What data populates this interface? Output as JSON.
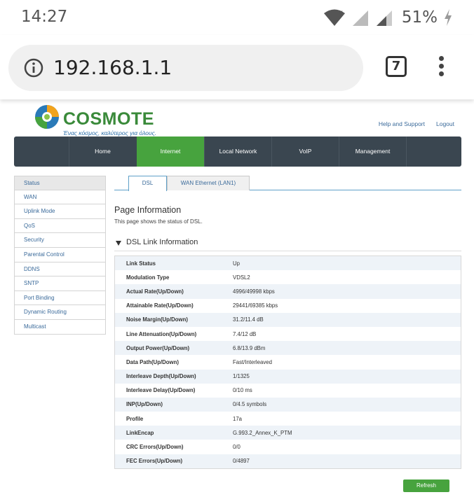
{
  "status_bar": {
    "time": "14:27",
    "battery": "51%",
    "icons": [
      "wifi-icon",
      "signal-no-sim-icon",
      "signal-icon",
      "charging-bolt-icon"
    ]
  },
  "browser": {
    "url": "192.168.1.1",
    "tab_count": "7"
  },
  "brand": {
    "name": "COSMOTE",
    "tagline": "Ένας κόσμος, καλύτερος για όλους.",
    "green": "#47a33e",
    "nav_bg": "#3a4650"
  },
  "top_links": {
    "help": "Help and Support",
    "logout": "Logout"
  },
  "main_nav": [
    {
      "label": "Home"
    },
    {
      "label": "Internet",
      "active": true
    },
    {
      "label": "Local Network"
    },
    {
      "label": "VoIP"
    },
    {
      "label": "Management"
    }
  ],
  "sidebar": [
    "Status",
    "WAN",
    "Uplink Mode",
    "QoS",
    "Security",
    "Parental Control",
    "DDNS",
    "SNTP",
    "Port Binding",
    "Dynamic Routing",
    "Multicast"
  ],
  "tabs": [
    {
      "label": "DSL",
      "active": true
    },
    {
      "label": "WAN Ethernet (LAN1)"
    }
  ],
  "page_info": {
    "title": "Page Information",
    "description": "This page shows the status of DSL."
  },
  "section": {
    "title": "DSL Link Information"
  },
  "rows": [
    {
      "label": "Link Status",
      "value": "Up"
    },
    {
      "label": "Modulation Type",
      "value": "VDSL2"
    },
    {
      "label": "Actual Rate(Up/Down)",
      "value": "4996/49998 kbps"
    },
    {
      "label": "Attainable Rate(Up/Down)",
      "value": "29441/69385 kbps"
    },
    {
      "label": "Noise Margin(Up/Down)",
      "value": "31.2/11.4 dB"
    },
    {
      "label": "Line Attenuation(Up/Down)",
      "value": "7.4/12 dB"
    },
    {
      "label": "Output Power(Up/Down)",
      "value": "6.8/13.9 dBm"
    },
    {
      "label": "Data Path(Up/Down)",
      "value": "Fast/Interleaved"
    },
    {
      "label": "Interleave Depth(Up/Down)",
      "value": "1/1325"
    },
    {
      "label": "Interleave Delay(Up/Down)",
      "value": "0/10 ms"
    },
    {
      "label": "INP(Up/Down)",
      "value": "0/4.5 symbols"
    },
    {
      "label": "Profile",
      "value": "17a"
    },
    {
      "label": "LinkEncap",
      "value": "G.993.2_Annex_K_PTM"
    },
    {
      "label": "CRC Errors(Up/Down)",
      "value": "0/0"
    },
    {
      "label": "FEC Errors(Up/Down)",
      "value": "0/4897"
    }
  ],
  "refresh_label": "Refresh"
}
